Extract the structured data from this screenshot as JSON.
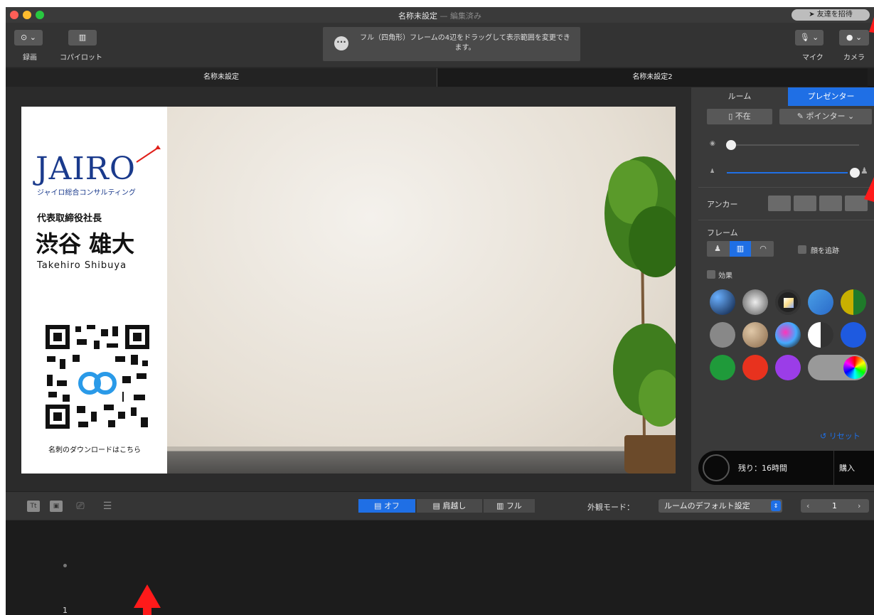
{
  "window": {
    "title": "名称未設定",
    "title_suffix": " — 編集済み",
    "invite_label": "友達を招待"
  },
  "toolbar": {
    "record_label": "録画",
    "copilot_label": "コパイロット",
    "notice_text": "フル（四角形）フレームの4辺をドラッグして表示範囲を変更できます。",
    "mic_label": "マイク",
    "camera_label": "カメラ"
  },
  "tabs": [
    {
      "label": "名称未設定"
    },
    {
      "label": "名称未設定2"
    }
  ],
  "card": {
    "logo": "JAIRO",
    "company": "ジャイロ総合コンサルティング",
    "role": "代表取締役社長",
    "name_jp": "渋谷 雄大",
    "name_en": "Takehiro Shibuya",
    "download_text": "名刺のダウンロードはこちら"
  },
  "panel": {
    "tab_room": "ルーム",
    "tab_presenter": "プレゼンター",
    "absent_label": "不在",
    "pointer_label": "ポインター",
    "slider1_value": 0.03,
    "slider2_value": 0.97,
    "anchor_label": "アンカー",
    "frame_label": "フレーム",
    "face_track_label": "顔を追跡",
    "effects_label": "効果",
    "reset_label": "リセット",
    "remaining_label": "残り：16時間",
    "buy_label": "購入",
    "swatch_colors": {
      "blue": "#1e5ae0",
      "green": "#1f9a3a",
      "red": "#e8321e",
      "purple": "#9b3de8"
    }
  },
  "bottombar": {
    "seg_off": "オフ",
    "seg_shoulder": "肩越し",
    "seg_full": "フル",
    "mode_label": "外観モード：",
    "mode_value": "ルームのデフォルト設定",
    "page_number": "1"
  },
  "slidelist": {
    "slide_number": "1"
  },
  "colors": {
    "accent": "#1f6fe5",
    "annotation_red": "#ff1a1a"
  }
}
